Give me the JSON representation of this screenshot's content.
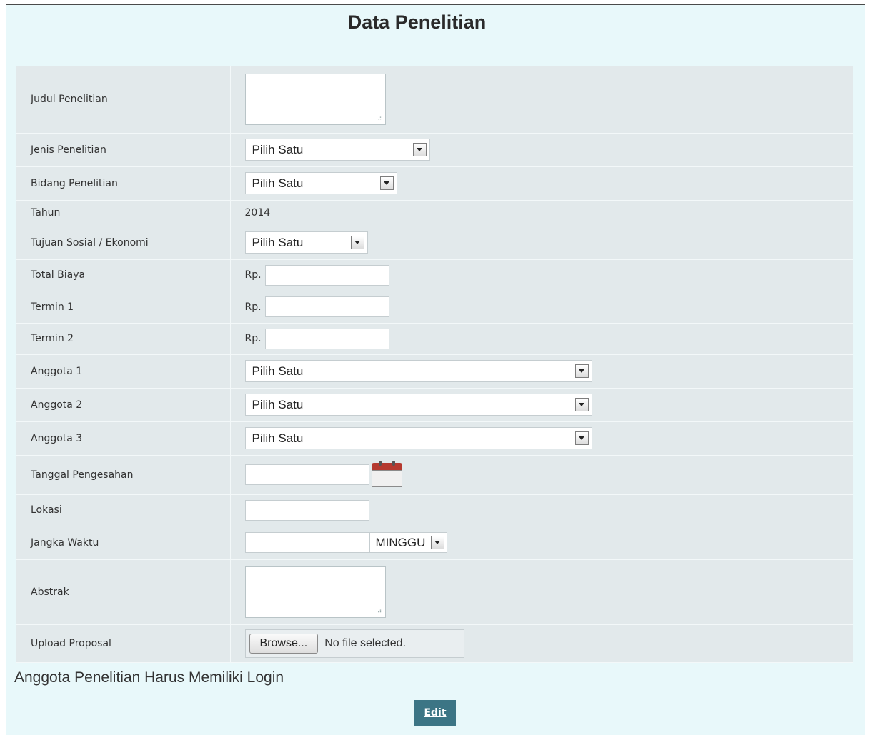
{
  "title": "Data Penelitian",
  "form": {
    "judul": {
      "label": "Judul Penelitian",
      "value": ""
    },
    "jenis": {
      "label": "Jenis Penelitian",
      "selected": "Pilih Satu"
    },
    "bidang": {
      "label": "Bidang Penelitian",
      "selected": "Pilih Satu"
    },
    "tahun": {
      "label": "Tahun",
      "value": "2014"
    },
    "tujuan": {
      "label": "Tujuan Sosial / Ekonomi",
      "selected": "Pilih Satu"
    },
    "total_biaya": {
      "label": "Total Biaya",
      "prefix": "Rp.",
      "value": ""
    },
    "termin1": {
      "label": "Termin 1",
      "prefix": "Rp.",
      "value": ""
    },
    "termin2": {
      "label": "Termin 2",
      "prefix": "Rp.",
      "value": ""
    },
    "anggota1": {
      "label": "Anggota 1",
      "selected": "Pilih Satu"
    },
    "anggota2": {
      "label": "Anggota 2",
      "selected": "Pilih Satu"
    },
    "anggota3": {
      "label": "Anggota 3",
      "selected": "Pilih Satu"
    },
    "tanggal": {
      "label": "Tanggal Pengesahan",
      "value": "",
      "icon": "calendar-icon"
    },
    "lokasi": {
      "label": "Lokasi",
      "value": ""
    },
    "jangka": {
      "label": "Jangka Waktu",
      "value": "",
      "unit": "MINGGU"
    },
    "abstrak": {
      "label": "Abstrak",
      "value": ""
    },
    "upload": {
      "label": "Upload Proposal",
      "browse": "Browse...",
      "status": "No file selected."
    }
  },
  "note": "Anggota Penelitian Harus Memiliki Login",
  "edit_button": "Edit",
  "colors": {
    "page_bg": "#e8f8fa",
    "row_bg": "#e2e9eb",
    "button_bg": "#3c7585"
  }
}
